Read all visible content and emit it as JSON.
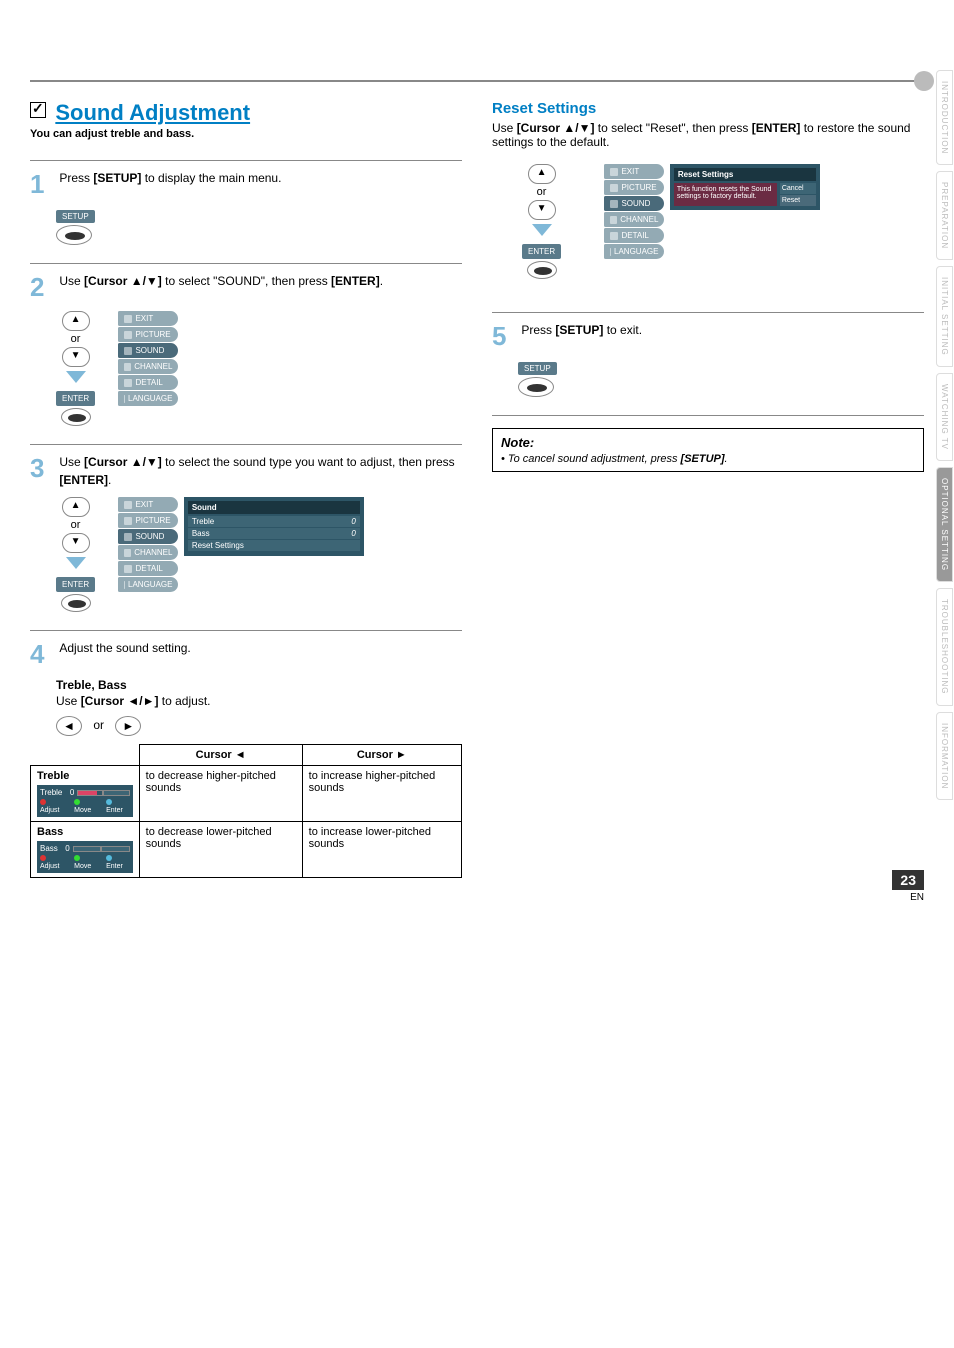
{
  "header": {
    "section_title": "Sound Adjustment",
    "description": "You can adjust treble and bass."
  },
  "steps": {
    "s1": {
      "num": "1",
      "text_pre": "Press ",
      "btn": "[SETUP]",
      "text_post": " to display the main menu."
    },
    "s2": {
      "num": "2",
      "text_pre": "Use ",
      "btn": "[Cursor ▲/▼]",
      "text_mid": " to select \"SOUND\", then press ",
      "btn2": "[ENTER]",
      "text_post": "."
    },
    "s3": {
      "num": "3",
      "text_pre": "Use ",
      "btn": "[Cursor ▲/▼]",
      "text_mid": " to select the sound type you want to adjust, then press ",
      "btn2": "[ENTER]",
      "text_post": "."
    },
    "s4": {
      "num": "4",
      "text": "Adjust the sound setting."
    },
    "s5": {
      "num": "5",
      "text_pre": "Press ",
      "btn": "[SETUP]",
      "text_post": " to exit."
    }
  },
  "remote": {
    "setup_label": "SETUP",
    "enter_label": "ENTER",
    "or": "or"
  },
  "osd_menu": {
    "items": [
      "EXIT",
      "PICTURE",
      "SOUND",
      "CHANNEL",
      "DETAIL",
      "LANGUAGE"
    ]
  },
  "osd_sound_panel": {
    "title": "Sound",
    "rows": [
      {
        "label": "Treble",
        "value": "0"
      },
      {
        "label": "Bass",
        "value": "0"
      },
      {
        "label": "Reset Settings",
        "value": ""
      }
    ]
  },
  "treble_bass": {
    "heading": "Treble, Bass",
    "instruction_pre": "Use ",
    "instruction_btn": "[Cursor ◄/►]",
    "instruction_post": " to adjust.",
    "table": {
      "head_left": "Cursor ◄",
      "head_right": "Cursor ►",
      "rows": [
        {
          "name": "Treble",
          "left": "to decrease higher-pitched sounds",
          "right": "to increase higher-pitched sounds"
        },
        {
          "name": "Bass",
          "left": "to decrease lower-pitched sounds",
          "right": "to increase lower-pitched sounds"
        }
      ]
    },
    "bar_controls": {
      "adjust": "Adjust",
      "move": "Move",
      "enter": "Enter"
    }
  },
  "reset": {
    "title": "Reset Settings",
    "text_pre": "Use ",
    "btn": "[Cursor ▲/▼]",
    "text_mid": " to select \"Reset\", then press ",
    "btn2": "[ENTER]",
    "text_post": " to restore the sound settings to the default.",
    "panel_title": "Reset Settings",
    "panel_msg1": "This function resets the Sound",
    "panel_msg2": "settings to factory default.",
    "cancel": "Cancel",
    "reset_btn": "Reset"
  },
  "note": {
    "title": "Note:",
    "item_pre": "• To cancel sound adjustment, press ",
    "item_btn": "[SETUP]",
    "item_post": "."
  },
  "tabs": [
    "INTRODUCTION",
    "PREPARATION",
    "INITIAL SETTING",
    "WATCHING TV",
    "OPTIONAL SETTING",
    "TROUBLESHOOTING",
    "INFORMATION"
  ],
  "page": {
    "num": "23",
    "lang": "EN"
  }
}
